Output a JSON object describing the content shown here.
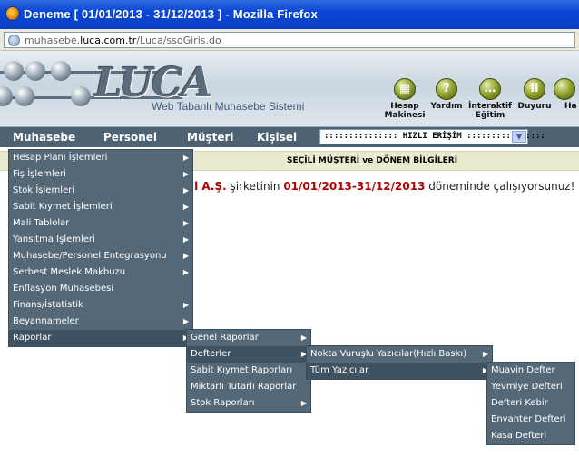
{
  "window": {
    "title": "Deneme [ 01/01/2013 - 31/12/2013 ] - Mozilla Firefox",
    "url_prefix": "muhasebe.",
    "url_domain": "luca.com.tr",
    "url_path": "/Luca/ssoGiris.do"
  },
  "banner": {
    "logo": "LUCA",
    "tagline": "Web Tabanlı Muhasebe Sistemi",
    "buttons": [
      {
        "label": "Hesap Makinesi",
        "icon": "calculator-icon"
      },
      {
        "label": "Yardım",
        "icon": "help-icon"
      },
      {
        "label": "İnteraktif Eğitim",
        "icon": "chat-icon"
      },
      {
        "label": "Duyuru",
        "icon": "announcement-icon"
      },
      {
        "label": "Ha",
        "icon": "news-icon"
      }
    ]
  },
  "menubar": {
    "items": [
      "Muhasebe",
      "Personel",
      "Müşteri",
      "Kişisel"
    ],
    "quick_access": "::::::::::::::: HIZLI ERİŞİM ::::::::::::::::"
  },
  "section_title": "SEÇİLİ MÜŞTERİ ve DÖNEM BİLGİLERİ",
  "notice": {
    "company": "il A.Ş.",
    "text1": " şirketinin ",
    "period": "01/01/2013-31/12/2013",
    "text2": " döneminde çalışıyorsunuz!"
  },
  "menu_muhasebe": [
    {
      "label": "Hesap Planı İşlemleri",
      "has_sub": true
    },
    {
      "label": "Fiş İşlemleri",
      "has_sub": true
    },
    {
      "label": "Stok İşlemleri",
      "has_sub": true
    },
    {
      "label": "Sabit Kıymet İşlemleri",
      "has_sub": true
    },
    {
      "label": "Mali Tablolar",
      "has_sub": true
    },
    {
      "label": "Yansıtma İşlemleri",
      "has_sub": true
    },
    {
      "label": "Muhasebe/Personel Entegrasyonu",
      "has_sub": true
    },
    {
      "label": "Serbest Meslek Makbuzu",
      "has_sub": true
    },
    {
      "label": "Enflasyon Muhasebesi",
      "has_sub": false
    },
    {
      "label": "Finans/İstatistik",
      "has_sub": true
    },
    {
      "label": "Beyannameler",
      "has_sub": true
    },
    {
      "label": "Raporlar",
      "has_sub": true
    }
  ],
  "menu_raporlar": [
    {
      "label": "Genel Raporlar",
      "has_sub": true
    },
    {
      "label": "Defterler",
      "has_sub": true
    },
    {
      "label": "Sabit Kıymet Raporları",
      "has_sub": false
    },
    {
      "label": "Miktarlı Tutarlı Raporlar",
      "has_sub": false
    },
    {
      "label": "Stok Raporları",
      "has_sub": true
    }
  ],
  "menu_defterler": [
    {
      "label": "Nokta Vuruşlu Yazıcılar(Hızlı Baskı)",
      "has_sub": true
    },
    {
      "label": "Tüm Yazıcılar",
      "has_sub": true
    }
  ],
  "menu_tum_yazicilar": [
    {
      "label": "Muavin Defter"
    },
    {
      "label": "Yevmiye Defteri"
    },
    {
      "label": "Defteri Kebir"
    },
    {
      "label": "Envanter Defteri"
    },
    {
      "label": "Kasa Defteri"
    }
  ]
}
